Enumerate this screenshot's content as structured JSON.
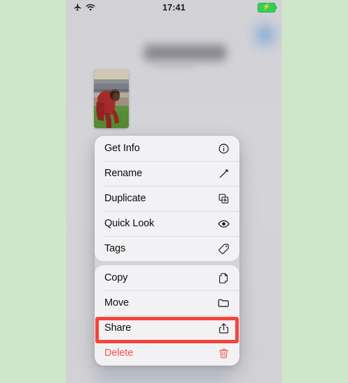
{
  "canvas": {
    "outer_background": "#cfe6cb",
    "screen_background": "#d3d3d7"
  },
  "status_bar": {
    "time": "17:41",
    "airplane_icon": "airplane-mode-icon",
    "wifi_icon": "wifi-icon",
    "battery_icon": "battery-charging-icon",
    "battery_color": "#30d158",
    "bolt_glyph": "⚡"
  },
  "content": {
    "title_redacted": "",
    "thumbnail_alt": "photo-thumbnail-soccer-player"
  },
  "context_menu": {
    "groups": [
      {
        "items": [
          {
            "label": "Get Info",
            "icon": "info-circle-icon",
            "destructive": false
          },
          {
            "label": "Rename",
            "icon": "pencil-icon",
            "destructive": false
          },
          {
            "label": "Duplicate",
            "icon": "duplicate-icon",
            "destructive": false
          },
          {
            "label": "Quick Look",
            "icon": "eye-icon",
            "destructive": false
          },
          {
            "label": "Tags",
            "icon": "tag-icon",
            "destructive": false
          }
        ]
      },
      {
        "items": [
          {
            "label": "Copy",
            "icon": "copy-icon",
            "destructive": false
          },
          {
            "label": "Move",
            "icon": "folder-icon",
            "destructive": false
          },
          {
            "label": "Share",
            "icon": "share-icon",
            "destructive": false
          },
          {
            "label": "Delete",
            "icon": "trash-icon",
            "destructive": true
          }
        ]
      }
    ],
    "highlighted_item": "Share",
    "highlight_color": "#f4453c",
    "destructive_color": "#f0554f"
  }
}
